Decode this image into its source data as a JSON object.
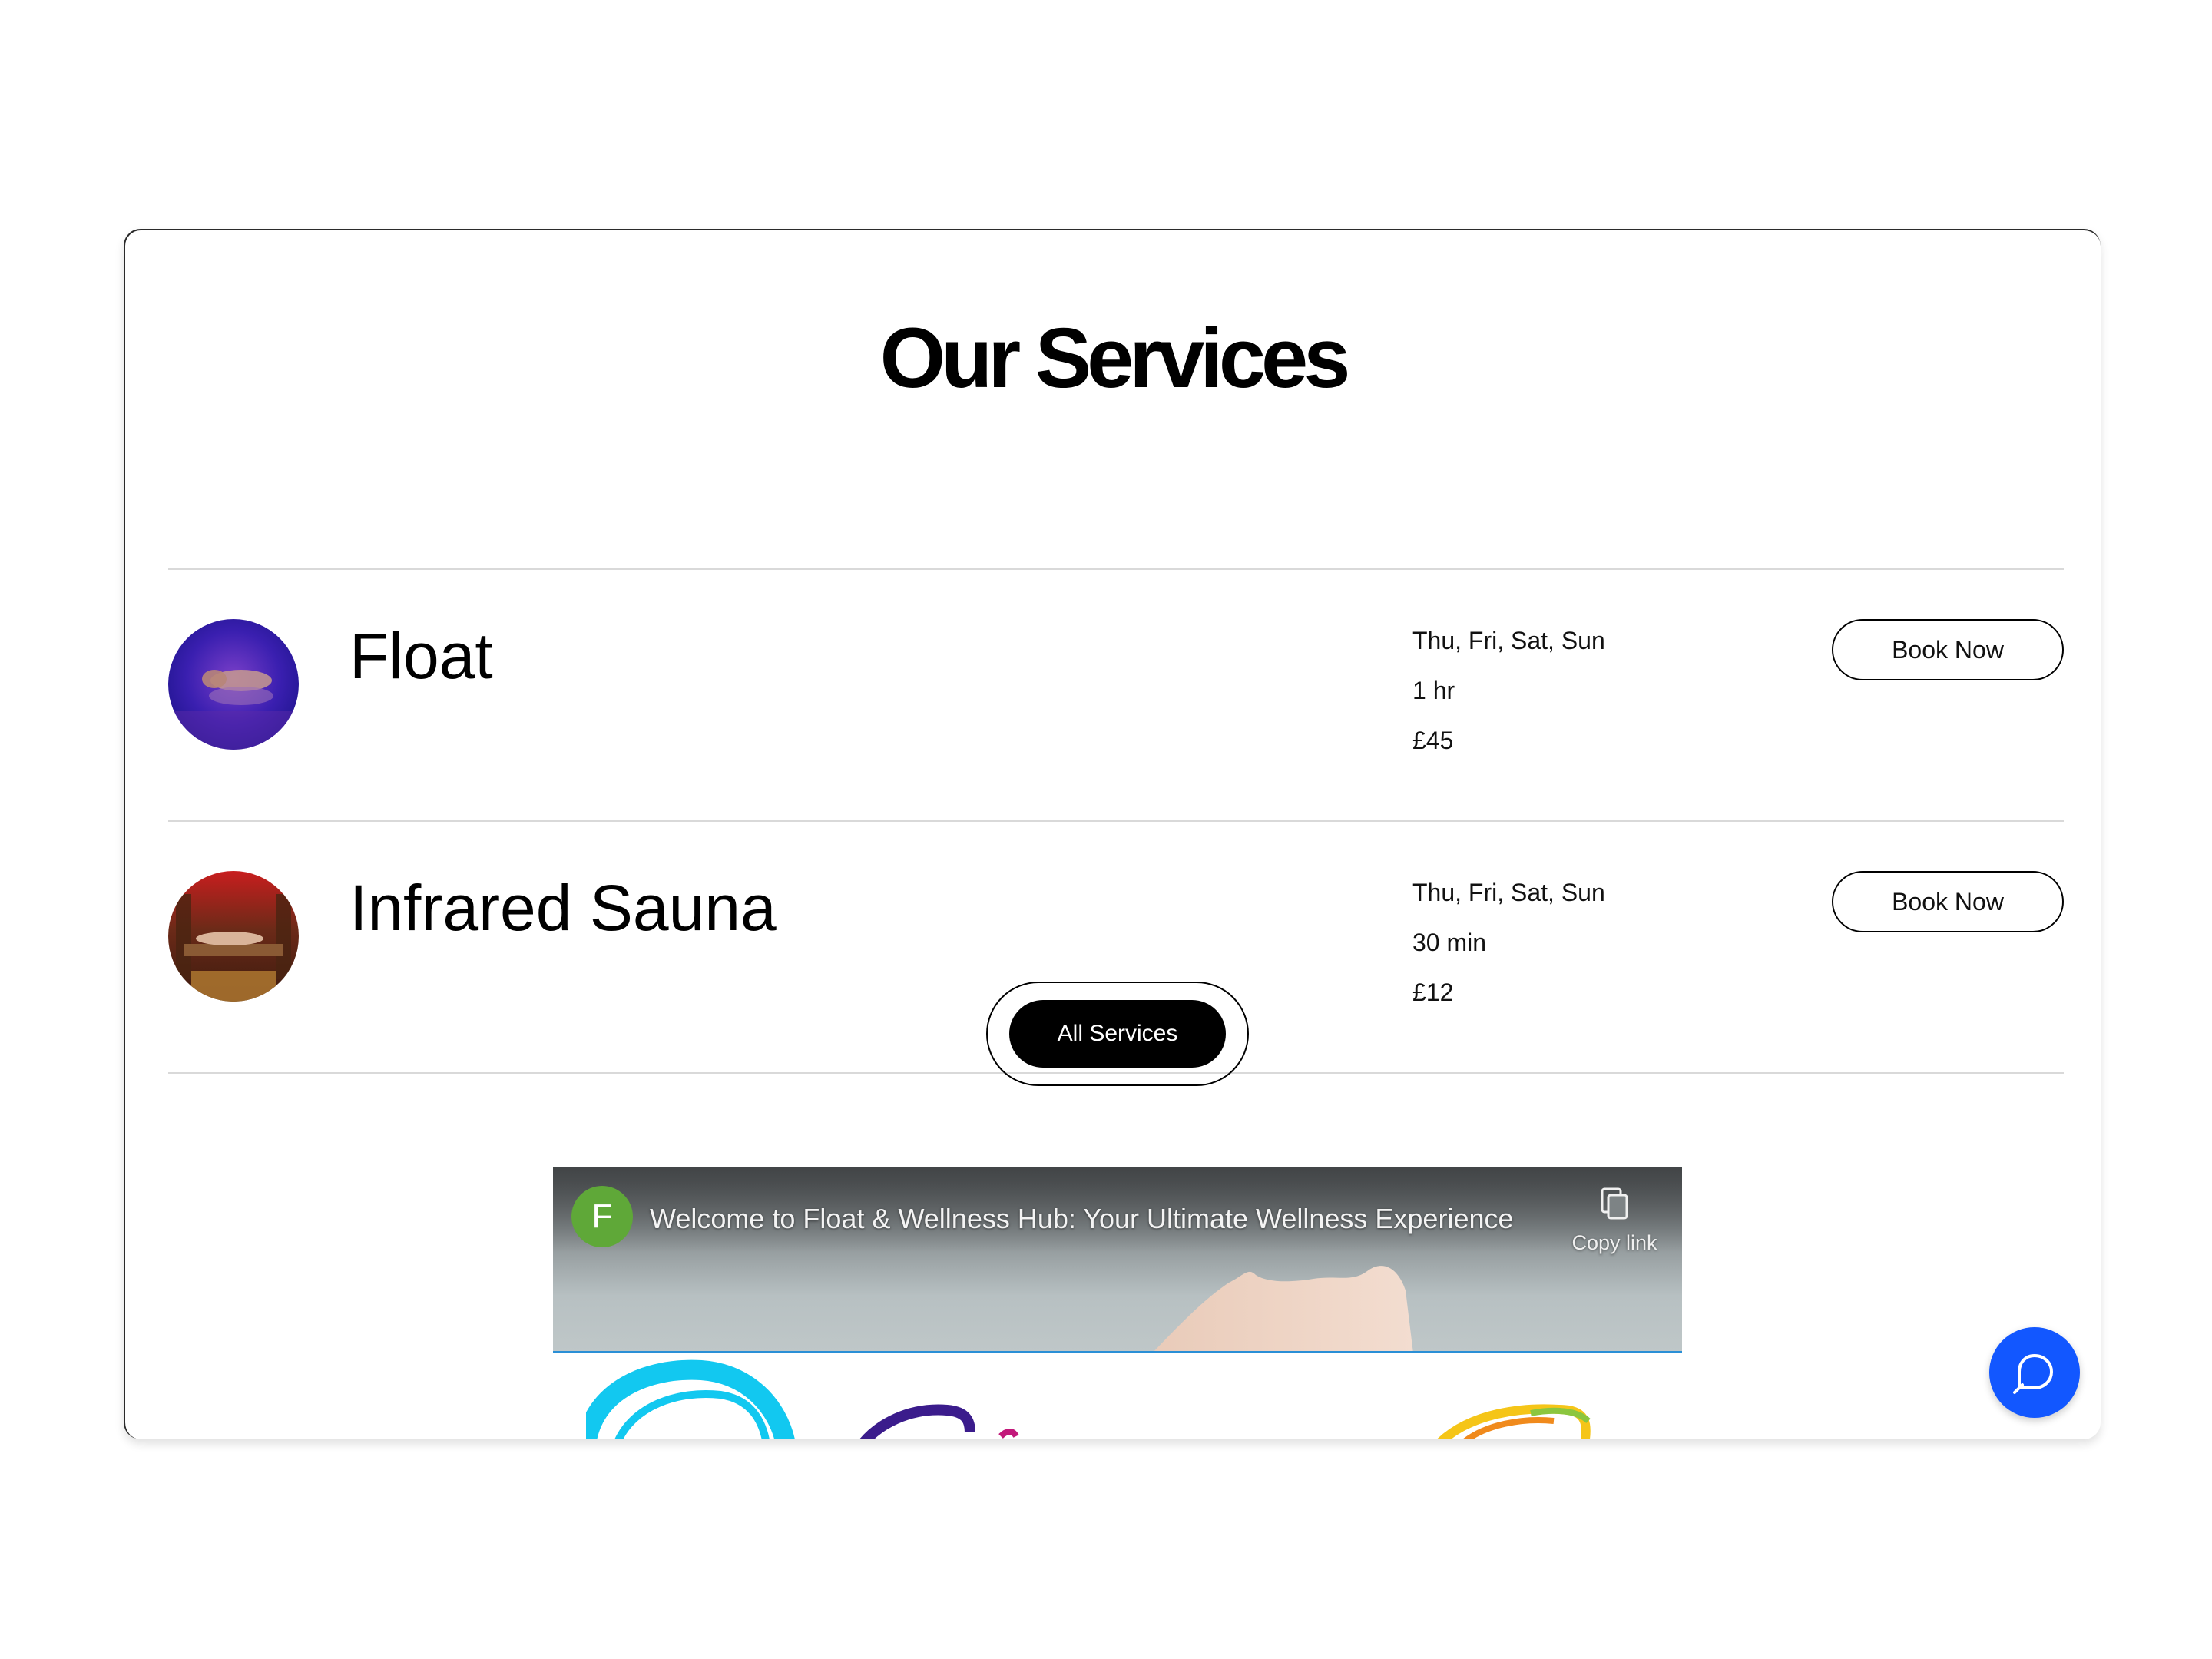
{
  "section": {
    "title": "Our Services"
  },
  "services": [
    {
      "name": "Float",
      "days": "Thu, Fri, Sat, Sun",
      "duration": "1 hr",
      "price": "£45",
      "book_label": "Book Now",
      "thumb_icon": "float-thumbnail"
    },
    {
      "name": "Infrared Sauna",
      "days": "Thu, Fri, Sat, Sun",
      "duration": "30 min",
      "price": "£12",
      "book_label": "Book Now",
      "thumb_icon": "sauna-thumbnail"
    }
  ],
  "all_services_label": "All Services",
  "video": {
    "channel_initial": "F",
    "title": "Welcome to Float & Wellness Hub: Your Ultimate Wellness Experience",
    "copy_link_label": "Copy link",
    "copy_icon": "copy-icon"
  },
  "chat": {
    "icon": "chat-bubble-icon",
    "color": "#1257ff"
  },
  "colors": {
    "accent": "#1257ff",
    "channel_avatar": "#5fa838",
    "video_progress": "#2a8fd6"
  }
}
